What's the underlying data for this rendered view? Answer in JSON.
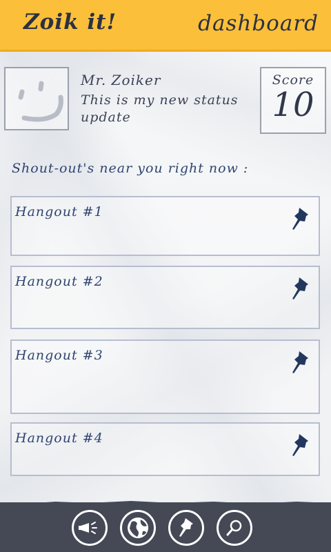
{
  "header": {
    "app_title": "Zoik it!",
    "page_title": "dashboard"
  },
  "profile": {
    "name": "Mr. Zoiker",
    "status": "This is my new status update",
    "avatar_icon": "smiley-icon"
  },
  "score": {
    "label": "Score",
    "value": "10"
  },
  "shoutouts": {
    "heading": "Shout-out's near you right now :",
    "items": [
      {
        "title": "Hangout #1",
        "icon": "pushpin-icon"
      },
      {
        "title": "Hangout #2",
        "icon": "pushpin-icon"
      },
      {
        "title": "Hangout #3",
        "icon": "pushpin-icon"
      },
      {
        "title": "Hangout #4",
        "icon": "pushpin-icon"
      }
    ]
  },
  "appbar": {
    "buttons": [
      {
        "icon": "megaphone-icon"
      },
      {
        "icon": "globe-icon"
      },
      {
        "icon": "pushpin-icon"
      },
      {
        "icon": "search-icon"
      }
    ]
  },
  "colors": {
    "header_bg": "#fbbf3a",
    "appbar_bg": "#444955",
    "accent_text": "#2f4470"
  }
}
